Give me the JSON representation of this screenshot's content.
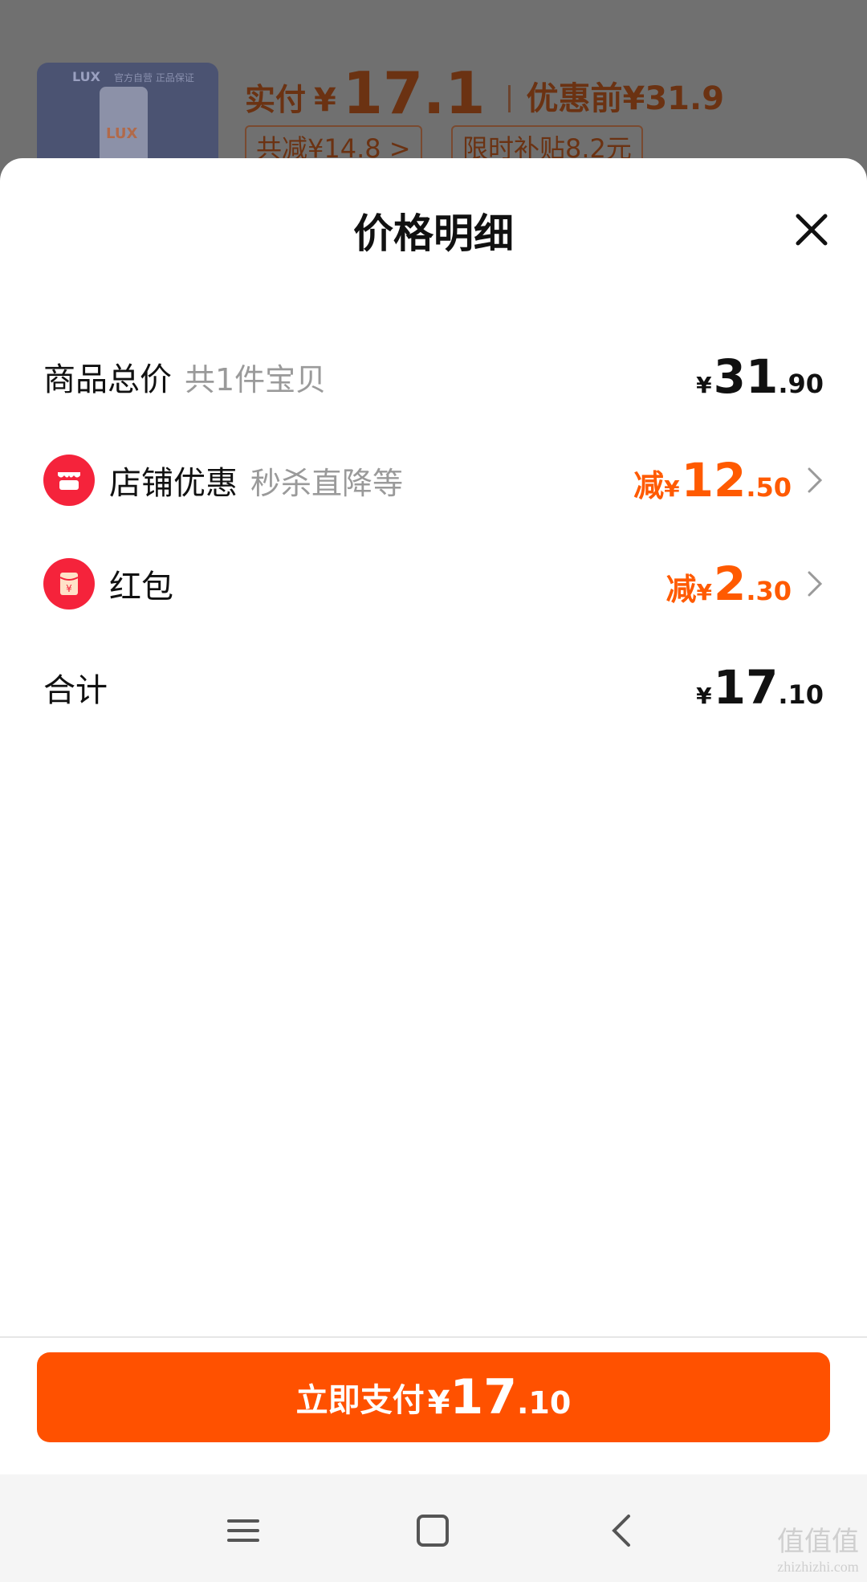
{
  "background": {
    "thumb_brand": "LUX",
    "thumb_subtext": "官方自营 正品保证",
    "paid_label": "实付",
    "paid_yen": "¥",
    "paid_amount": "17.1",
    "before_label": "优惠前¥31.9",
    "chip_total_reduce": "共减¥14.8 >",
    "chip_subsidy": "限时补贴8.2元"
  },
  "sheet": {
    "title": "价格明细",
    "close_icon": "close-icon"
  },
  "rows": [
    {
      "label": "商品总价",
      "sub": "共1件宝贝",
      "prefix": "",
      "yen": "¥",
      "int": "31",
      "dec": ".90",
      "color": "#111111"
    },
    {
      "label": "店铺优惠",
      "sub": "秒杀直降等",
      "prefix": "减",
      "yen": "¥",
      "int": "12",
      "dec": ".50",
      "color": "#ff5a00",
      "icon": "shop-icon"
    },
    {
      "label": "红包",
      "sub": "",
      "prefix": "减",
      "yen": "¥",
      "int": "2",
      "dec": ".30",
      "color": "#ff5a00",
      "icon": "red-packet-icon"
    },
    {
      "label": "合计",
      "sub": "",
      "prefix": "",
      "yen": "¥",
      "int": "17",
      "dec": ".10",
      "color": "#111111"
    }
  ],
  "pay_button": {
    "label": "立即支付",
    "yen": "¥",
    "int": "17",
    "dec": ".10",
    "color": "#ff5100"
  },
  "navbar": {
    "items": [
      "menu-icon",
      "home-icon",
      "back-icon"
    ]
  },
  "watermark": {
    "main": "值值值",
    "small": "zhizhizhi.com"
  }
}
